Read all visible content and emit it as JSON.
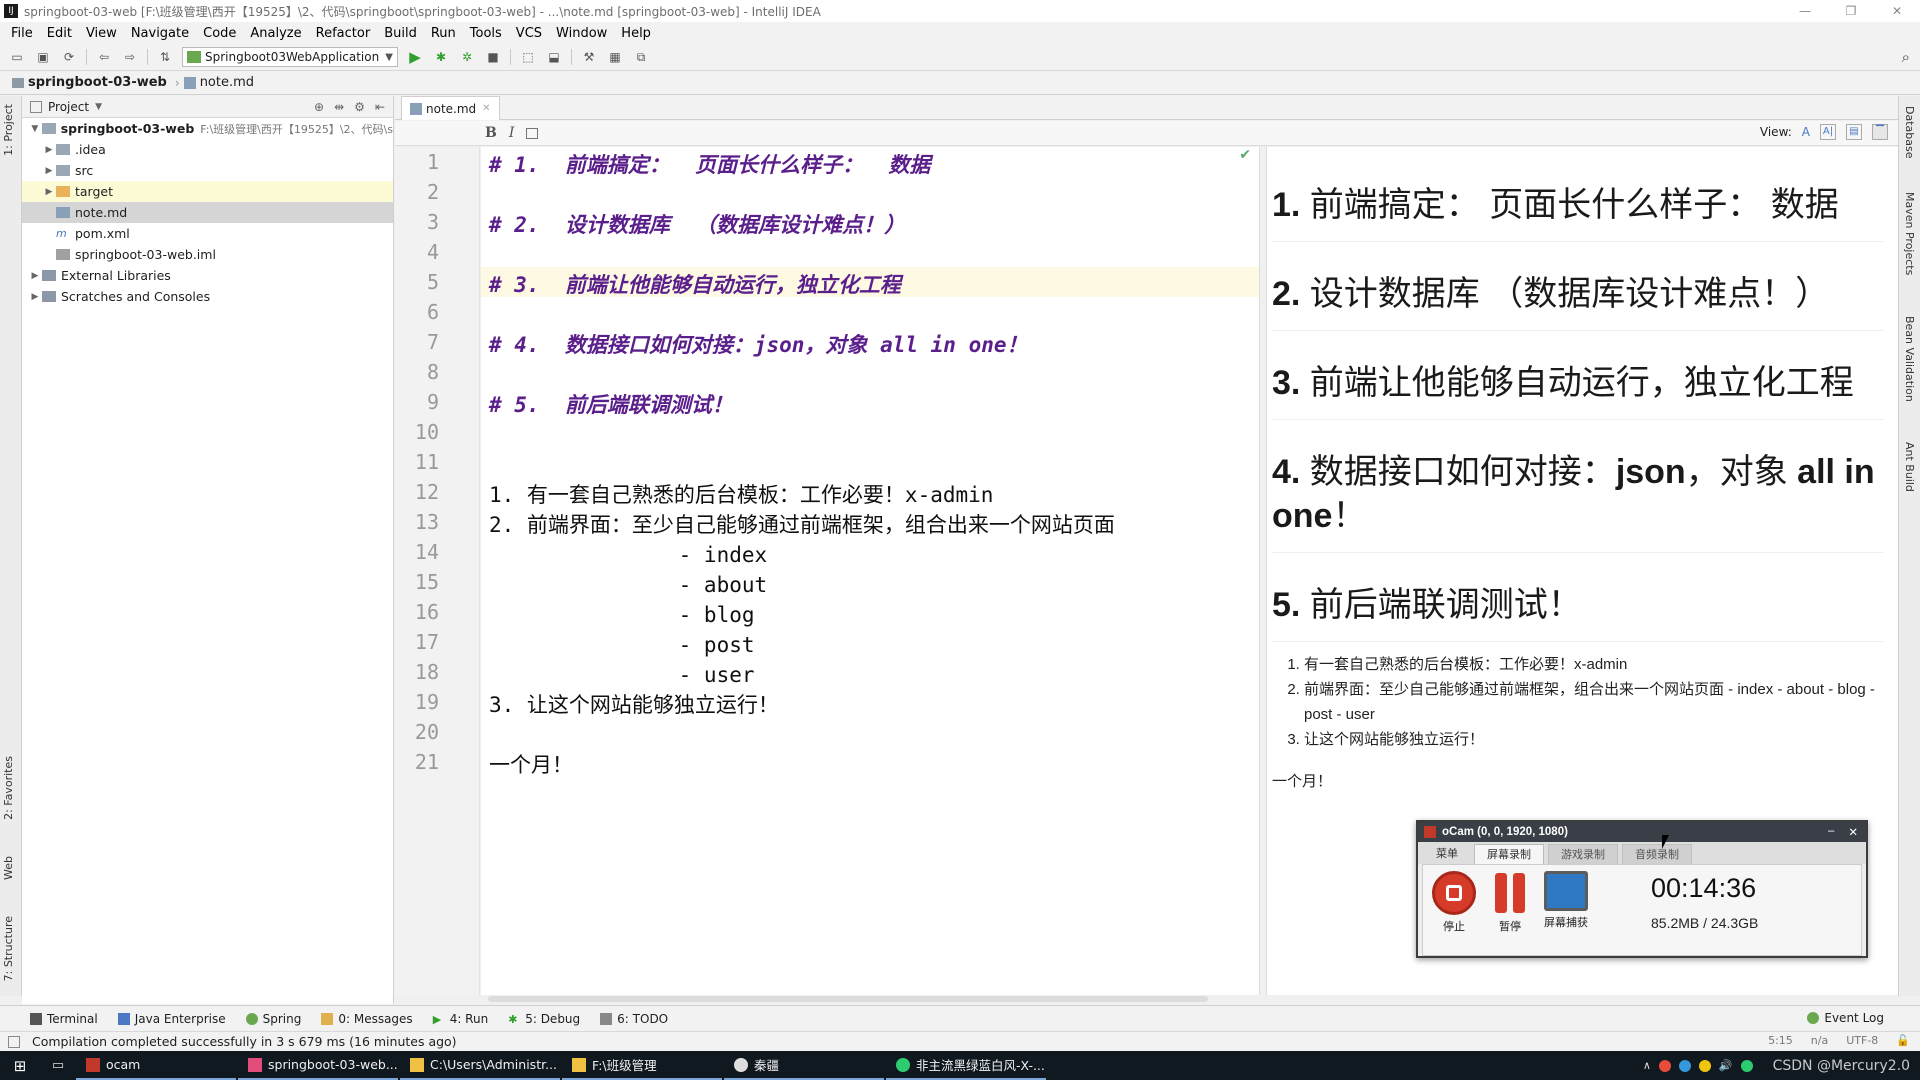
{
  "window": {
    "title": "springboot-03-web [F:\\班级管理\\西开【19525】\\2、代码\\springboot\\springboot-03-web] - ...\\note.md [springboot-03-web] - IntelliJ IDEA",
    "controls": [
      "—",
      "❐",
      "✕"
    ]
  },
  "menu": [
    "File",
    "Edit",
    "View",
    "Navigate",
    "Code",
    "Analyze",
    "Refactor",
    "Build",
    "Run",
    "Tools",
    "VCS",
    "Window",
    "Help"
  ],
  "toolbar": {
    "run_config": "Springboot03WebApplication"
  },
  "navbar": {
    "project": "springboot-03-web",
    "file": "note.md"
  },
  "left_tabs": {
    "project": "1: Project",
    "favorites": "2: Favorites",
    "web": "Web",
    "structure": "7: Structure"
  },
  "right_tabs": {
    "database": "Database",
    "maven": "Maven Projects",
    "bean": "Bean Validation",
    "ant": "Ant Build"
  },
  "project_panel": {
    "header": "Project",
    "root": "springboot-03-web",
    "root_path": "F:\\班级管理\\西开【19525】\\2、代码\\s",
    "items": [
      {
        "label": ".idea"
      },
      {
        "label": "src"
      },
      {
        "label": "target"
      },
      {
        "label": "note.md"
      },
      {
        "label": "pom.xml"
      },
      {
        "label": "springboot-03-web.iml"
      },
      {
        "label": "External Libraries"
      },
      {
        "label": "Scratches and Consoles"
      }
    ]
  },
  "editor": {
    "tab": "note.md",
    "view_label": "View:",
    "line_numbers": [
      "1",
      "2",
      "3",
      "4",
      "5",
      "6",
      "7",
      "8",
      "9",
      "10",
      "11",
      "12",
      "13",
      "14",
      "15",
      "16",
      "17",
      "18",
      "19",
      "20",
      "21"
    ],
    "lines": [
      "# 1.  前端搞定：  页面长什么样子：  数据",
      "",
      "# 2.  设计数据库  （数据库设计难点！）",
      "",
      "# 3.  前端让他能够自动运行，独立化工程",
      "",
      "# 4.  数据接口如何对接：json，对象 all in one！",
      "",
      "# 5.  前后端联调测试！",
      "",
      "",
      "1. 有一套自己熟悉的后台模板：工作必要！x-admin",
      "2. 前端界面：至少自己能够通过前端框架，组合出来一个网站页面",
      "               - index",
      "               - about",
      "               - blog",
      "               - post",
      "               - user",
      "3. 让这个网站能够独立运行！",
      "",
      "一个月！"
    ]
  },
  "preview": {
    "h1": {
      "num": "1.",
      "text": " 前端搞定：  页面长什么样子：  数据"
    },
    "h2": {
      "num": "2.",
      "text": " 设计数据库  （数据库设计难点！）"
    },
    "h3": {
      "num": "3.",
      "text": " 前端让他能够自动运行，独立化工程"
    },
    "h4": {
      "num": "4.",
      "pre": " 数据接口如何对接：",
      "b1": "json",
      "mid": "，对象 ",
      "b2": "all in one",
      "post": "！"
    },
    "h5": {
      "num": "5.",
      "text": " 前后端联调测试！"
    },
    "list": [
      "有一套自己熟悉的后台模板：工作必要！x-admin",
      "前端界面：至少自己能够通过前端框架，组合出来一个网站页面 - index - about - blog - post - user",
      "让这个网站能够独立运行！"
    ],
    "ending": "一个月！"
  },
  "bottom_tabs": [
    "Terminal",
    "Java Enterprise",
    "Spring",
    "0: Messages",
    "4: Run",
    "5: Debug",
    "6: TODO"
  ],
  "event_log": "Event Log",
  "status": {
    "message": "Compilation completed successfully in 3 s 679 ms (16 minutes ago)",
    "pos": "5:15",
    "na": "n/a",
    "encoding": "UTF-8"
  },
  "taskbar": {
    "items": [
      "ocam",
      "springboot-03-web...",
      "C:\\Users\\Administr...",
      "F:\\班级管理",
      "秦疆",
      "非主流黑绿蓝白风-X-..."
    ],
    "watermark": "CSDN @Mercury2.0"
  },
  "ocam": {
    "title": "oCam (0, 0, 1920, 1080)",
    "tabs": [
      "菜单",
      "屏幕录制",
      "游戏录制",
      "音频录制"
    ],
    "stop": "停止",
    "pause": "暂停",
    "capture": "屏幕捕获",
    "time": "00:14:36",
    "size": "85.2MB / 24.3GB"
  },
  "colors": {
    "header_purple": "#5b1f8c",
    "ocam_red": "#d63b2a",
    "run_green": "#33a02c"
  }
}
